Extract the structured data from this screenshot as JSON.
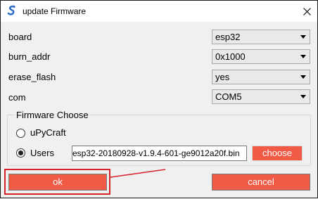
{
  "window": {
    "title": "update Firmware",
    "app_icon": "snake-logo-icon",
    "close_icon": "close-icon"
  },
  "settings": [
    {
      "label": "board",
      "value": "esp32"
    },
    {
      "label": "burn_addr",
      "value": "0x1000"
    },
    {
      "label": "erase_flash",
      "value": "yes"
    },
    {
      "label": "com",
      "value": "COM5"
    }
  ],
  "firmware": {
    "group_title": "Firmware Choose",
    "options": [
      {
        "label": "uPyCraft",
        "checked": false
      },
      {
        "label": "Users",
        "checked": true
      }
    ],
    "path_value": "esp32-20180928-v1.9.4-601-ge9012a20f.bin",
    "choose_label": "choose"
  },
  "actions": {
    "ok_label": "ok",
    "cancel_label": "cancel"
  },
  "colors": {
    "button_accent": "#f15a45",
    "annotation_red": "#d8222a",
    "dialog_bg": "#f0f0f0"
  }
}
